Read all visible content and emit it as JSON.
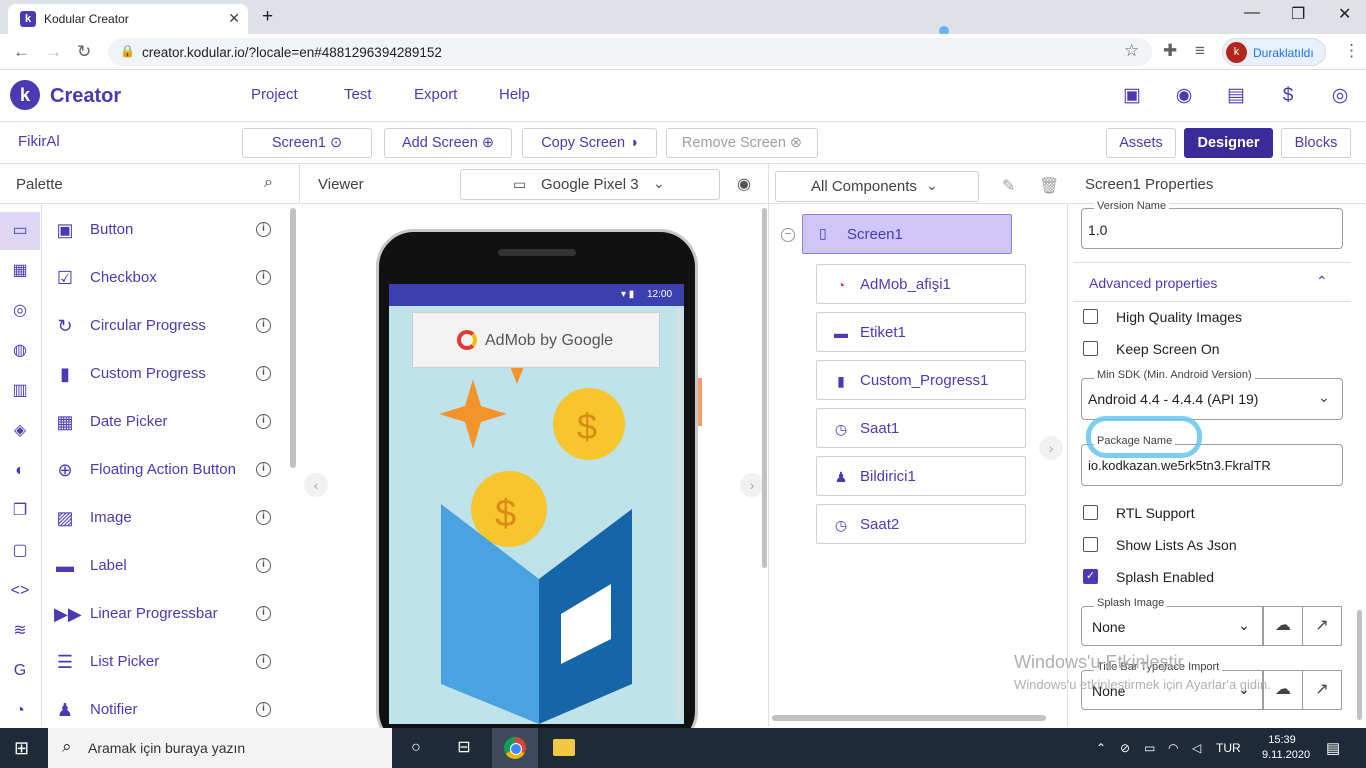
{
  "browser": {
    "tab_title": "Kodular Creator",
    "tab_favicon": "k",
    "url": "creator.kodular.io/?locale=en#4881296394289152",
    "profile_initial": "k",
    "profile_name": "Duraklatıldı",
    "icons": [
      "back-icon",
      "forward-icon",
      "reload-icon",
      "lock-icon",
      "star-icon",
      "extensions-icon",
      "media-icon",
      "menu-icon"
    ]
  },
  "app": {
    "logo_letter": "k",
    "name": "Creator",
    "menu": [
      "Project",
      "Test",
      "Export",
      "Help"
    ],
    "header_icons": [
      "folder-star-icon",
      "palette-icon",
      "library-icon",
      "dollar-icon",
      "account-icon"
    ],
    "accent": "#4a3bb5"
  },
  "toolbar": {
    "project_name": "FikirAl",
    "screen_selector": "Screen1",
    "add_screen": "Add Screen",
    "copy_screen": "Copy Screen",
    "remove_screen": "Remove Screen",
    "assets": "Assets",
    "designer": "Designer",
    "blocks": "Blocks"
  },
  "palette": {
    "title": "Palette",
    "items": [
      {
        "label": "Button",
        "icon": "button-icon"
      },
      {
        "label": "Checkbox",
        "icon": "checkbox-icon"
      },
      {
        "label": "Circular Progress",
        "icon": "circular-progress-icon"
      },
      {
        "label": "Custom Progress",
        "icon": "custom-progress-icon"
      },
      {
        "label": "Date Picker",
        "icon": "date-picker-icon"
      },
      {
        "label": "Floating Action Button",
        "icon": "fab-icon"
      },
      {
        "label": "Image",
        "icon": "image-icon"
      },
      {
        "label": "Label",
        "icon": "label-icon"
      },
      {
        "label": "Linear Progressbar",
        "icon": "linear-progressbar-icon"
      },
      {
        "label": "List Picker",
        "icon": "list-picker-icon"
      },
      {
        "label": "Notifier",
        "icon": "notifier-icon"
      }
    ]
  },
  "viewer": {
    "title": "Viewer",
    "device": "Google Pixel 3",
    "status_time": "12:00",
    "admob_text": "AdMob by Google"
  },
  "components": {
    "filter": "All Components",
    "root": "Screen1",
    "children": [
      {
        "label": "AdMob_afişi1",
        "icon": "admob-icon"
      },
      {
        "label": "Etiket1",
        "icon": "label-icon"
      },
      {
        "label": "Custom_Progress1",
        "icon": "custom-progress-icon"
      },
      {
        "label": "Saat1",
        "icon": "clock-icon"
      },
      {
        "label": "Bildirici1",
        "icon": "bell-icon"
      },
      {
        "label": "Saat2",
        "icon": "clock-icon"
      }
    ]
  },
  "properties": {
    "title": "Screen1 Properties",
    "version_name_label": "Version Name",
    "version_name": "1.0",
    "advanced_label": "Advanced properties",
    "high_quality_images": "High Quality Images",
    "keep_screen_on": "Keep Screen On",
    "min_sdk_label": "Min SDK (Min. Android Version)",
    "min_sdk": "Android 4.4 - 4.4.4 (API 19)",
    "package_label": "Package Name",
    "package_name": "io.kodkazan.we5rk5tn3.FkralTR",
    "rtl_support": "RTL Support",
    "show_lists_json": "Show Lists As Json",
    "splash_enabled": "Splash Enabled",
    "splash_image_label": "Splash Image",
    "splash_image": "None",
    "typeface_label": "Title Bar Typeface Import",
    "typeface": "None",
    "checks": {
      "high_quality_images": false,
      "keep_screen_on": false,
      "rtl_support": false,
      "show_lists_json": false,
      "splash_enabled": true
    }
  },
  "watermark": {
    "line1": "Windows'u Etkinleştir",
    "line2": "Windows'u etkinleştirmek için Ayarlar'a gidin."
  },
  "taskbar": {
    "search_placeholder": "Aramak için buraya yazın",
    "language": "TUR",
    "time": "15:39",
    "date": "9.11.2020"
  }
}
